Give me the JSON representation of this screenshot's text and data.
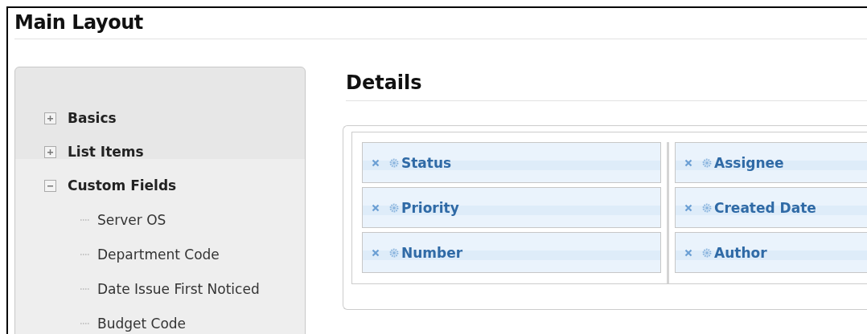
{
  "title": "Main Layout",
  "tree": [
    {
      "label": "Basics",
      "expanded": false
    },
    {
      "label": "List Items",
      "expanded": false
    },
    {
      "label": "Custom Fields",
      "expanded": true,
      "children": [
        {
          "label": "Server OS"
        },
        {
          "label": "Department Code"
        },
        {
          "label": "Date Issue First Noticed"
        },
        {
          "label": "Budget Code"
        }
      ]
    }
  ],
  "section": {
    "title": "Details",
    "columns": [
      [
        "Status",
        "Priority",
        "Number"
      ],
      [
        "Assignee",
        "Created Date",
        "Author"
      ]
    ]
  }
}
